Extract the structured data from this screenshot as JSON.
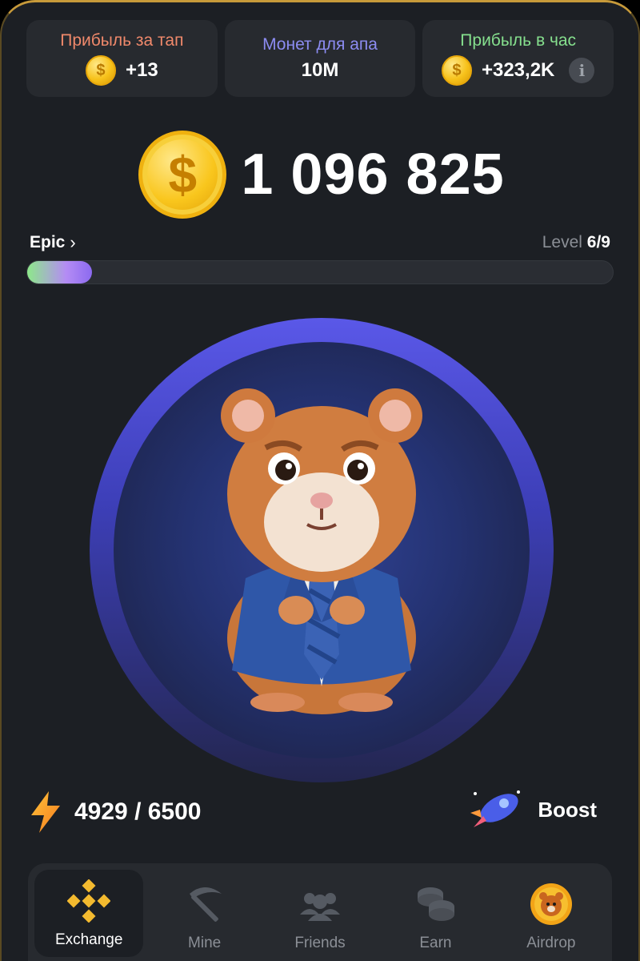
{
  "stats": [
    {
      "label": "Прибыль за тап",
      "value": "+13",
      "label_color": "#f0896b",
      "icon": "coin-icon"
    },
    {
      "label": "Монет для апа",
      "value": "10M",
      "label_color": "#8c8cf2"
    },
    {
      "label": "Прибыль в час",
      "value": "+323,2K",
      "label_color": "#86e08e",
      "icon": "coin-icon",
      "info_icon": "i"
    }
  ],
  "coin_symbol": "$",
  "balance": "1 096 825",
  "rank": {
    "name": "Epic",
    "chevron": "›"
  },
  "level": {
    "label": "Level",
    "value": "6/9",
    "progress": 0.11
  },
  "energy": {
    "value": "4929 / 6500"
  },
  "boost": {
    "label": "Boost"
  },
  "nav": [
    {
      "label": "Exchange",
      "icon": "binance-icon",
      "active": true
    },
    {
      "label": "Mine",
      "icon": "pickaxe-icon"
    },
    {
      "label": "Friends",
      "icon": "friends-icon"
    },
    {
      "label": "Earn",
      "icon": "coins-stack-icon"
    },
    {
      "label": "Airdrop",
      "icon": "hamster-coin-icon"
    }
  ],
  "colors": {
    "accent": "#f7c21b",
    "background": "#1c1f24",
    "card": "#272a2f",
    "ring": "#5a58e8"
  }
}
